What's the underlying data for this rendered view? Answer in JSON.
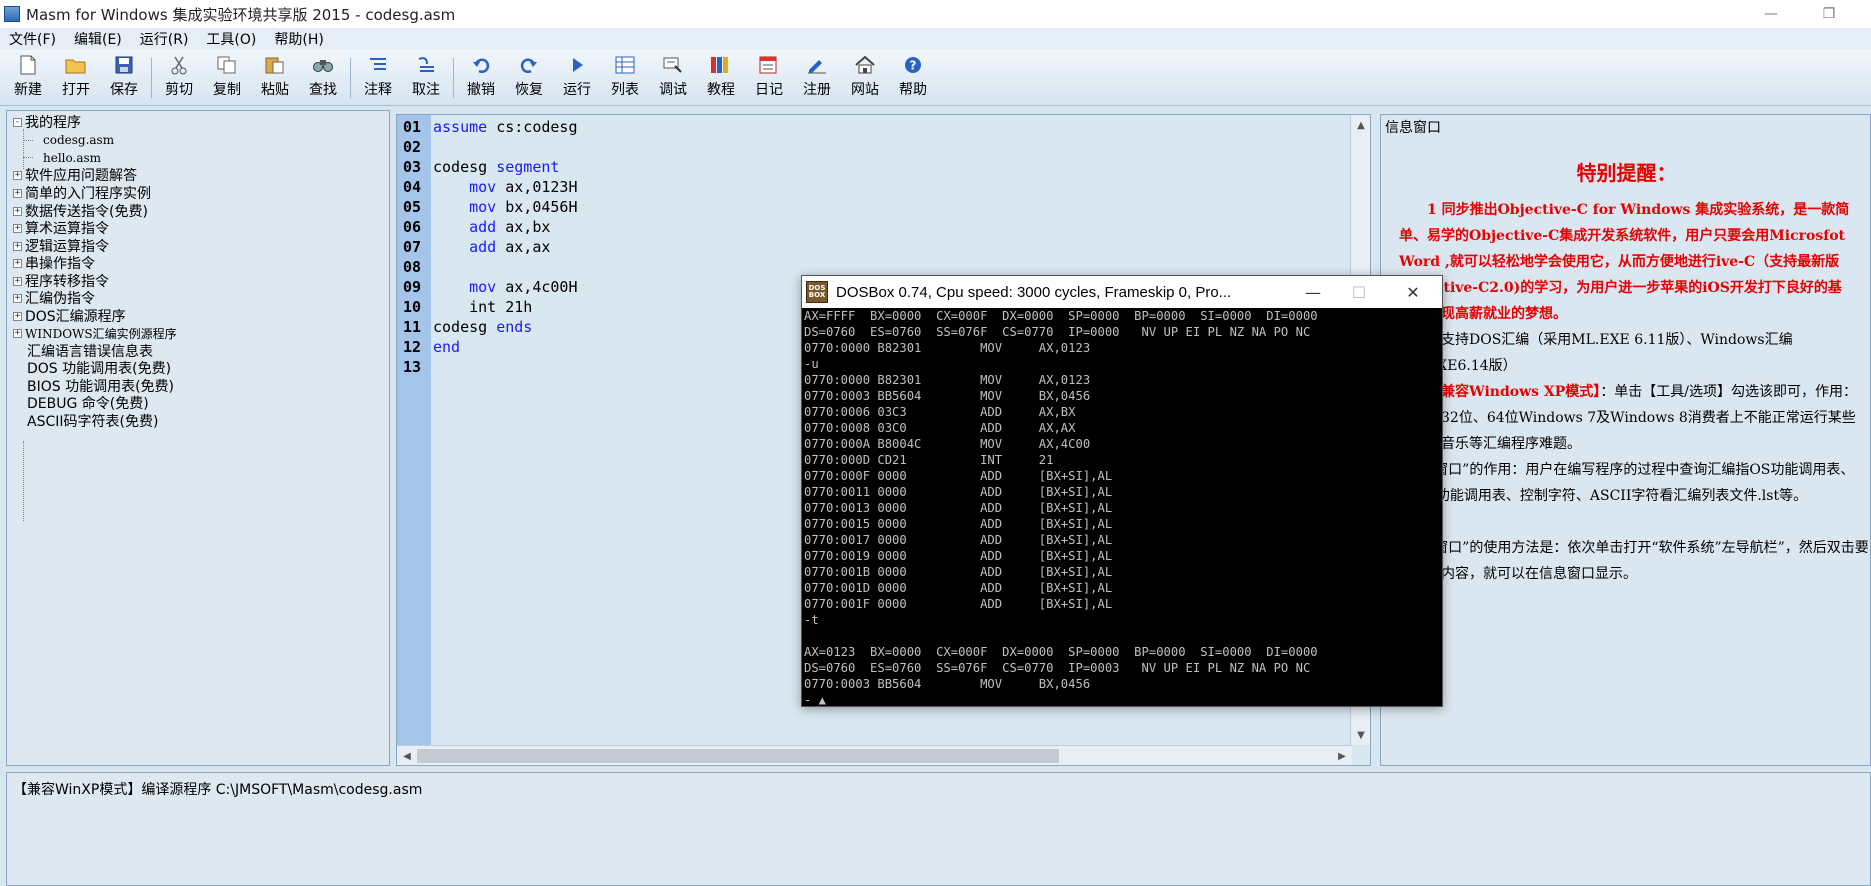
{
  "window": {
    "title": "Masm for Windows 集成实验环境共享版 2015 - codesg.asm",
    "minimize": "—",
    "maximize": "❐"
  },
  "menu": [
    "文件(F)",
    "编辑(E)",
    "运行(R)",
    "工具(O)",
    "帮助(H)"
  ],
  "toolbar": [
    {
      "label": "新建",
      "icon": "new-file-icon"
    },
    {
      "label": "打开",
      "icon": "open-folder-icon"
    },
    {
      "label": "保存",
      "icon": "save-icon"
    },
    {
      "label": "剪切",
      "icon": "cut-icon"
    },
    {
      "label": "复制",
      "icon": "copy-icon"
    },
    {
      "label": "粘贴",
      "icon": "paste-icon"
    },
    {
      "label": "查找",
      "icon": "find-icon"
    },
    {
      "label": "注释",
      "icon": "comment-icon"
    },
    {
      "label": "取注",
      "icon": "uncomment-icon"
    },
    {
      "label": "撤销",
      "icon": "undo-icon"
    },
    {
      "label": "恢复",
      "icon": "redo-icon"
    },
    {
      "label": "运行",
      "icon": "run-icon"
    },
    {
      "label": "列表",
      "icon": "list-icon"
    },
    {
      "label": "调试",
      "icon": "debug-icon"
    },
    {
      "label": "教程",
      "icon": "tutorial-icon"
    },
    {
      "label": "日记",
      "icon": "diary-icon"
    },
    {
      "label": "注册",
      "icon": "register-icon"
    },
    {
      "label": "网站",
      "icon": "website-icon"
    },
    {
      "label": "帮助",
      "icon": "help-icon"
    }
  ],
  "tree": {
    "root": "我的程序",
    "files": [
      "codesg.asm",
      "hello.asm"
    ],
    "items": [
      "软件应用问题解答",
      "简单的入门程序实例",
      "数据传送指令(免费)",
      "算术运算指令",
      "逻辑运算指令",
      "串操作指令",
      "程序转移指令",
      "汇编伪指令",
      "DOS汇编源程序",
      "WINDOWS汇编实例源程序",
      "汇编语言错误信息表",
      "DOS 功能调用表(免费)",
      "BIOS 功能调用表(免费)",
      "DEBUG 命令(免费)",
      "ASCII码字符表(免费)"
    ]
  },
  "editor": {
    "lines": [
      {
        "num": "01",
        "pre": "",
        "kw": "assume",
        "post": " cs:codesg"
      },
      {
        "num": "02",
        "pre": "",
        "kw": "",
        "post": ""
      },
      {
        "num": "03",
        "pre": "codesg ",
        "kw": "segment",
        "post": ""
      },
      {
        "num": "04",
        "pre": "    ",
        "kw": "mov",
        "post": " ax,0123H"
      },
      {
        "num": "05",
        "pre": "    ",
        "kw": "mov",
        "post": " bx,0456H"
      },
      {
        "num": "06",
        "pre": "    ",
        "kw": "add",
        "post": " ax,bx"
      },
      {
        "num": "07",
        "pre": "    ",
        "kw": "add",
        "post": " ax,ax"
      },
      {
        "num": "08",
        "pre": "",
        "kw": "",
        "post": ""
      },
      {
        "num": "09",
        "pre": "    ",
        "kw": "mov",
        "post": " ax,4c00H"
      },
      {
        "num": "10",
        "pre": "    int 21h",
        "kw": "",
        "post": ""
      },
      {
        "num": "11",
        "pre": "codesg ",
        "kw": "ends",
        "post": ""
      },
      {
        "num": "12",
        "pre": "",
        "kw": "end",
        "post": ""
      },
      {
        "num": "13",
        "pre": "",
        "kw": "",
        "post": ""
      }
    ]
  },
  "info": {
    "header": "信息窗口",
    "title": "特别提醒：",
    "p1": "　　1 同步推出Objective-C for Windows 集成实验系统，是一款简单、易学的Objective-C集成开发系统软件，用户只要会用Microsfot Word ,就可以轻松地学会使用它，从而方便地进行ive-C（支持最新版Objective-C2.0)的学习，为用户进一步苹果的iOS开发打下良好的基础，实现高薪就业的梦想。",
    "p2": "　软件支持DOS汇编（采用ML.EXE 6.11版）、Windows汇编ML.EXE6.14版）",
    "p3_red": "【设置兼容Windows XP模式】",
    "p3": "：单击【工具/选项】勾选该即可，作用：解决在32位、64位Windows 7及Windows 8消费者上不能正常运行某些绘图、音乐等汇编程序难题。",
    "p4": "“信息窗口”的作用：用户在编写程序的过程中查询汇编指OS功能调用表、BIOS功能调用表、控制字符、ASCII字符看汇编列表文件.lst等。",
    "p5": "“信息窗口”的使用方法是：依次单击打开“软件系统”左导航栏”，然后双击要打开的内容，就可以在信息窗口显示。"
  },
  "output": {
    "text": "【兼容WinXP模式】编译源程序 C:\\JMSOFT\\Masm\\codesg.asm"
  },
  "dosbox": {
    "title": "DOSBox 0.74, Cpu speed:     3000 cycles, Frameskip  0, Pro...",
    "icon_text": "DOS BOX",
    "lines": [
      "AX=FFFF  BX=0000  CX=000F  DX=0000  SP=0000  BP=0000  SI=0000  DI=0000",
      "DS=0760  ES=0760  SS=076F  CS=0770  IP=0000   NV UP EI PL NZ NA PO NC",
      "0770:0000 B82301        MOV     AX,0123",
      "-u",
      "0770:0000 B82301        MOV     AX,0123",
      "0770:0003 BB5604        MOV     BX,0456",
      "0770:0006 03C3          ADD     AX,BX",
      "0770:0008 03C0          ADD     AX,AX",
      "0770:000A B8004C        MOV     AX,4C00",
      "0770:000D CD21          INT     21",
      "0770:000F 0000          ADD     [BX+SI],AL",
      "0770:0011 0000          ADD     [BX+SI],AL",
      "0770:0013 0000          ADD     [BX+SI],AL",
      "0770:0015 0000          ADD     [BX+SI],AL",
      "0770:0017 0000          ADD     [BX+SI],AL",
      "0770:0019 0000          ADD     [BX+SI],AL",
      "0770:001B 0000          ADD     [BX+SI],AL",
      "0770:001D 0000          ADD     [BX+SI],AL",
      "0770:001F 0000          ADD     [BX+SI],AL",
      "-t",
      "",
      "AX=0123  BX=0000  CX=000F  DX=0000  SP=0000  BP=0000  SI=0000  DI=0000",
      "DS=0760  ES=0760  SS=076F  CS=0770  IP=0003   NV UP EI PL NZ NA PO NC",
      "0770:0003 BB5604        MOV     BX,0456",
      "- ▲_"
    ]
  }
}
